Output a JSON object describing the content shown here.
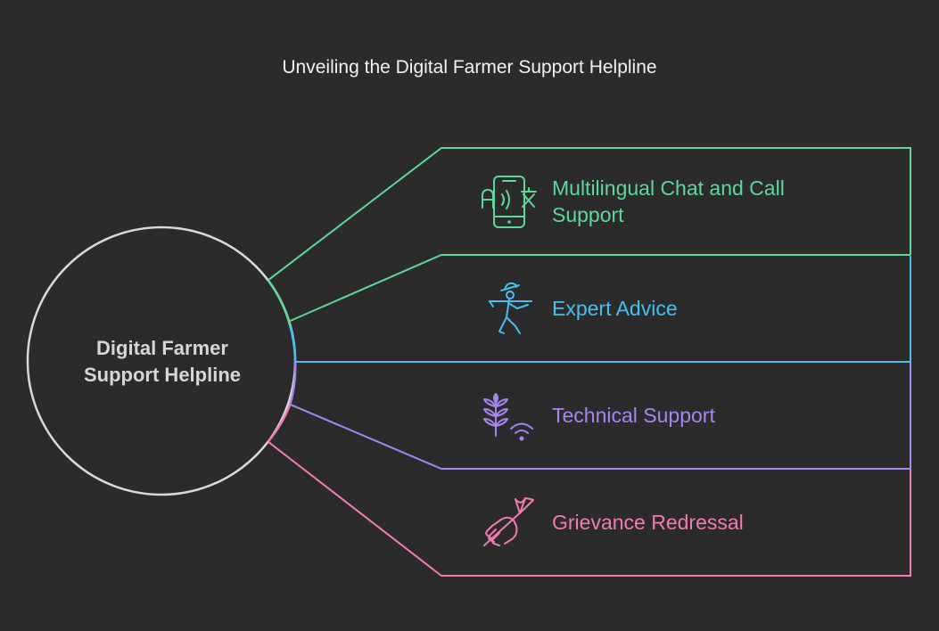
{
  "title": "Unveiling the Digital Farmer Support Helpline",
  "hub": {
    "line1": "Digital Farmer",
    "line2": "Support Helpline"
  },
  "items": [
    {
      "line1": "Multilingual Chat and Call",
      "line2": "Support",
      "icon": "multilingual-phone-icon",
      "color": "#5ed79b"
    },
    {
      "line1": "Expert Advice",
      "icon": "farmer-icon",
      "color": "#45c0ee"
    },
    {
      "line1": "Technical Support",
      "icon": "wheat-wifi-icon",
      "color": "#a685f0"
    },
    {
      "line1": "Grievance Redressal",
      "icon": "hand-pitchfork-icon",
      "color": "#f07ab4"
    }
  ]
}
